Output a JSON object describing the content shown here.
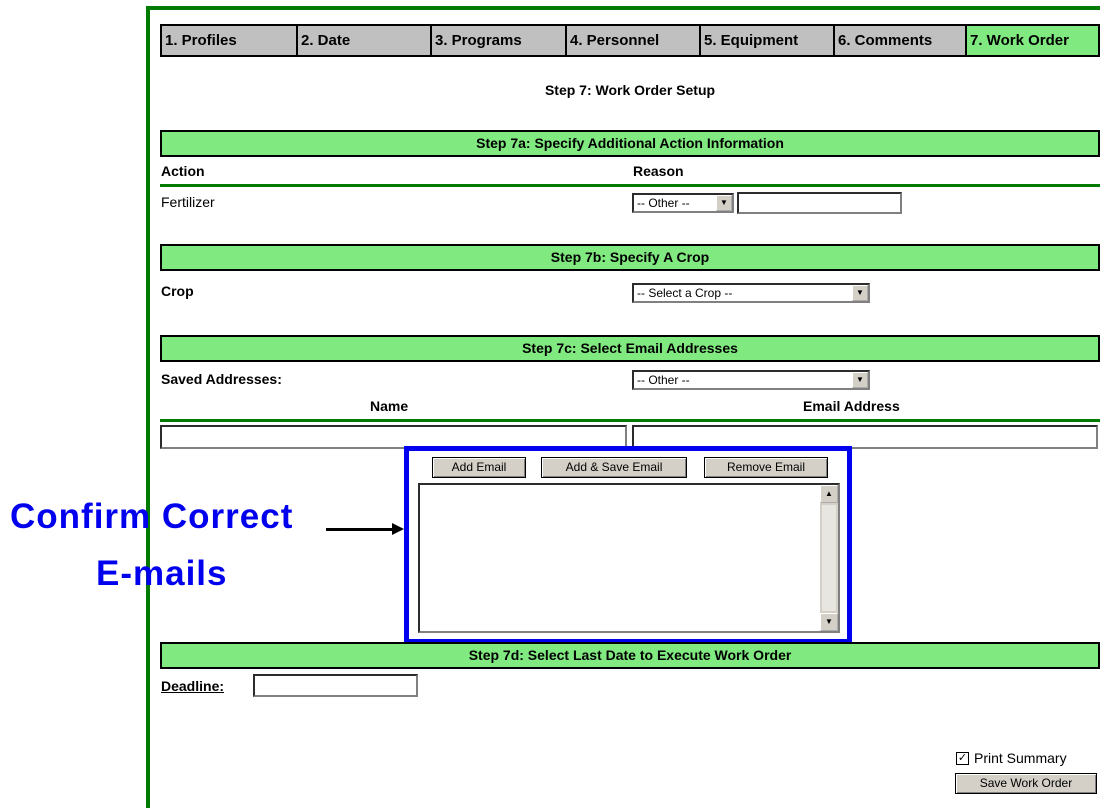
{
  "tabs": [
    {
      "label": "1. Profiles"
    },
    {
      "label": "2. Date"
    },
    {
      "label": "3. Programs"
    },
    {
      "label": "4. Personnel"
    },
    {
      "label": "5. Equipment"
    },
    {
      "label": "6. Comments"
    },
    {
      "label": "7. Work Order"
    }
  ],
  "page_title": "Step 7: Work Order Setup",
  "step7a": {
    "heading": "Step 7a: Specify Additional Action Information",
    "action_col": "Action",
    "reason_col": "Reason",
    "action_value": "Fertilizer",
    "reason_select": "-- Other --"
  },
  "step7b": {
    "heading": "Step 7b: Specify A Crop",
    "crop_label": "Crop",
    "crop_select": "-- Select a Crop --"
  },
  "step7c": {
    "heading": "Step 7c: Select Email Addresses",
    "saved_label": "Saved Addresses:",
    "saved_select": "-- Other --",
    "name_col": "Name",
    "email_col": "Email Address",
    "add_email": "Add Email",
    "add_save_email": "Add & Save Email",
    "remove_email": "Remove Email"
  },
  "step7d": {
    "heading": "Step 7d: Select Last Date to Execute Work Order",
    "deadline_label": "Deadline:"
  },
  "print_summary": "Print Summary",
  "save_button": "Save Work Order",
  "callout": {
    "line1": "Confirm Correct",
    "line2": "E-mails"
  },
  "colors": {
    "accent_green": "#80ea80",
    "border_green": "#007a00",
    "callout_blue": "#0000ee"
  }
}
